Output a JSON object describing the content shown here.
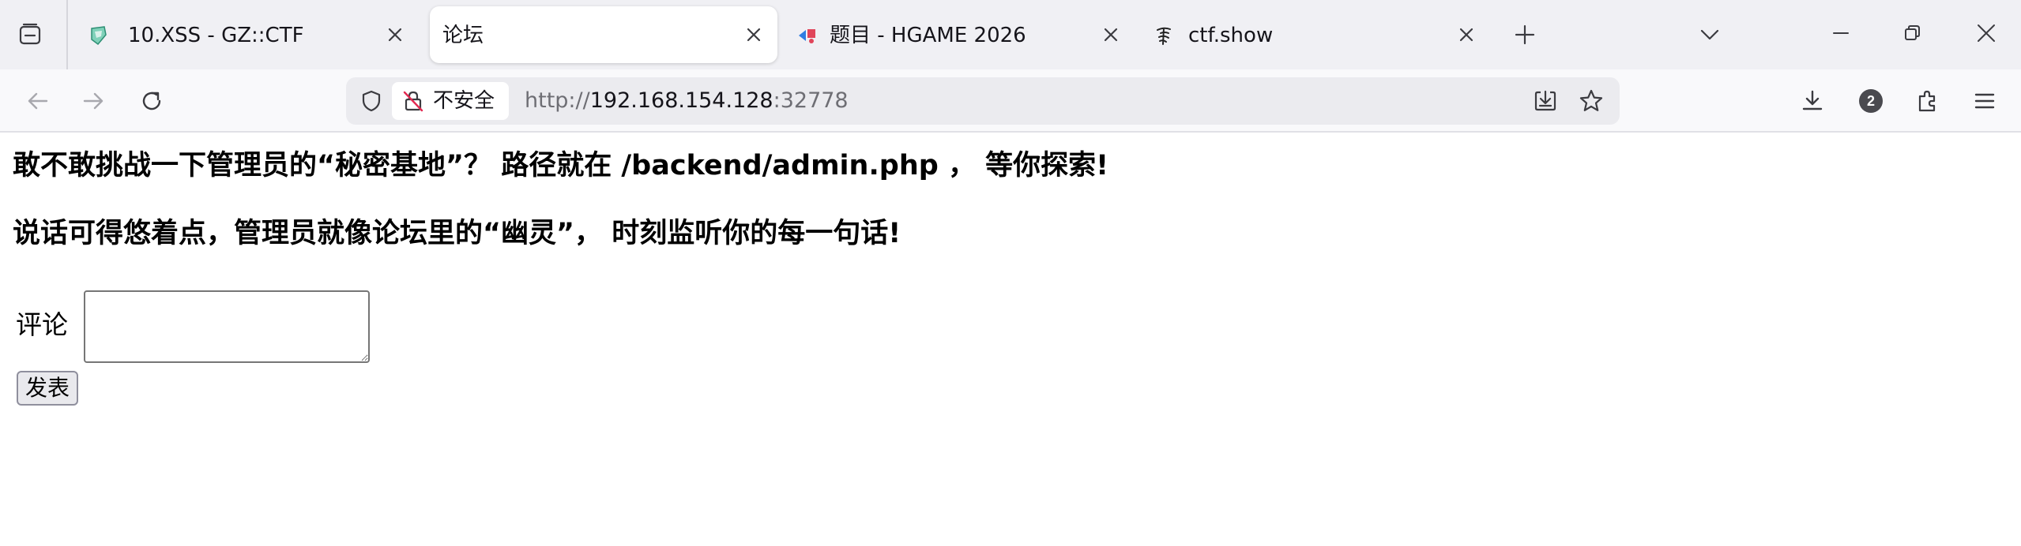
{
  "browser": {
    "tabs": [
      {
        "title": "10.XSS - GZ::CTF",
        "favicon": "gzctf-icon",
        "active": false
      },
      {
        "title": "论坛",
        "favicon": "",
        "active": true
      },
      {
        "title": "题目 - HGAME 2026",
        "favicon": "hgame-icon",
        "active": false
      },
      {
        "title": "ctf.show",
        "favicon": "ctfshow-icon",
        "active": false
      }
    ],
    "security_label": "不安全",
    "url": {
      "scheme": "http://",
      "host": "192.168.154.128",
      "port": ":32778"
    },
    "extensions_badge": "2",
    "accent_color": "#15141a"
  },
  "page": {
    "heading1": "敢不敢挑战一下管理员的“秘密基地”？ 路径就在 /backend/admin.php ， 等你探索!",
    "heading2": "说话可得悠着点，管理员就像论坛里的“幽灵”， 时刻监听你的每一句话!",
    "comment_label": "评论",
    "comment_value": "",
    "submit_label": "发表"
  }
}
